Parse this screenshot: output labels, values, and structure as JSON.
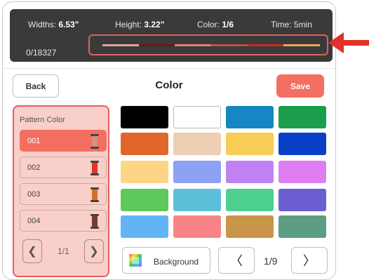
{
  "stats": {
    "width_label": "Widths: ",
    "width_value": "6.53\"",
    "height_label": "Height: ",
    "height_value": "3.22\"",
    "color_label": "Color: ",
    "color_value": "1/6",
    "time_label": "Time: ",
    "time_value": "5min"
  },
  "counter": "0/18327",
  "progress_colors": [
    "#d9a7a1",
    "#6a1a16",
    "#d9856e",
    "#b05447",
    "#c8291f",
    "#e8a75d"
  ],
  "header": {
    "back_label": "Back",
    "title": "Color",
    "save_label": "Save"
  },
  "pattern_panel": {
    "title": "Pattern Color",
    "items": [
      {
        "label": "001",
        "color": "#d98d83",
        "selected": true
      },
      {
        "label": "002",
        "color": "#e0352e",
        "selected": false
      },
      {
        "label": "003",
        "color": "#e06b25",
        "selected": false
      },
      {
        "label": "004",
        "color": "#7a3a2c",
        "selected": false
      }
    ],
    "page": "1/1",
    "prev_icon": "chevron-left-icon",
    "next_icon": "chevron-right-icon"
  },
  "palette": [
    "#000000",
    "#ffffff",
    "#1687c2",
    "#1b9e4b",
    "#e2662a",
    "#efcfb3",
    "#f8cd55",
    "#0a40c8",
    "#fdd586",
    "#8fa1f5",
    "#c082f2",
    "#df7ef0",
    "#5fc85a",
    "#5ebfda",
    "#4dcf8d",
    "#6b5ed2",
    "#61b5f6",
    "#f98487",
    "#c99548",
    "#5d9e82"
  ],
  "footer": {
    "background_label": "Background",
    "page": "1/9",
    "prev_icon": "chevron-left-icon",
    "next_icon": "chevron-right-icon"
  },
  "accent": "#f46f61",
  "annotation_color": "#e2605a"
}
